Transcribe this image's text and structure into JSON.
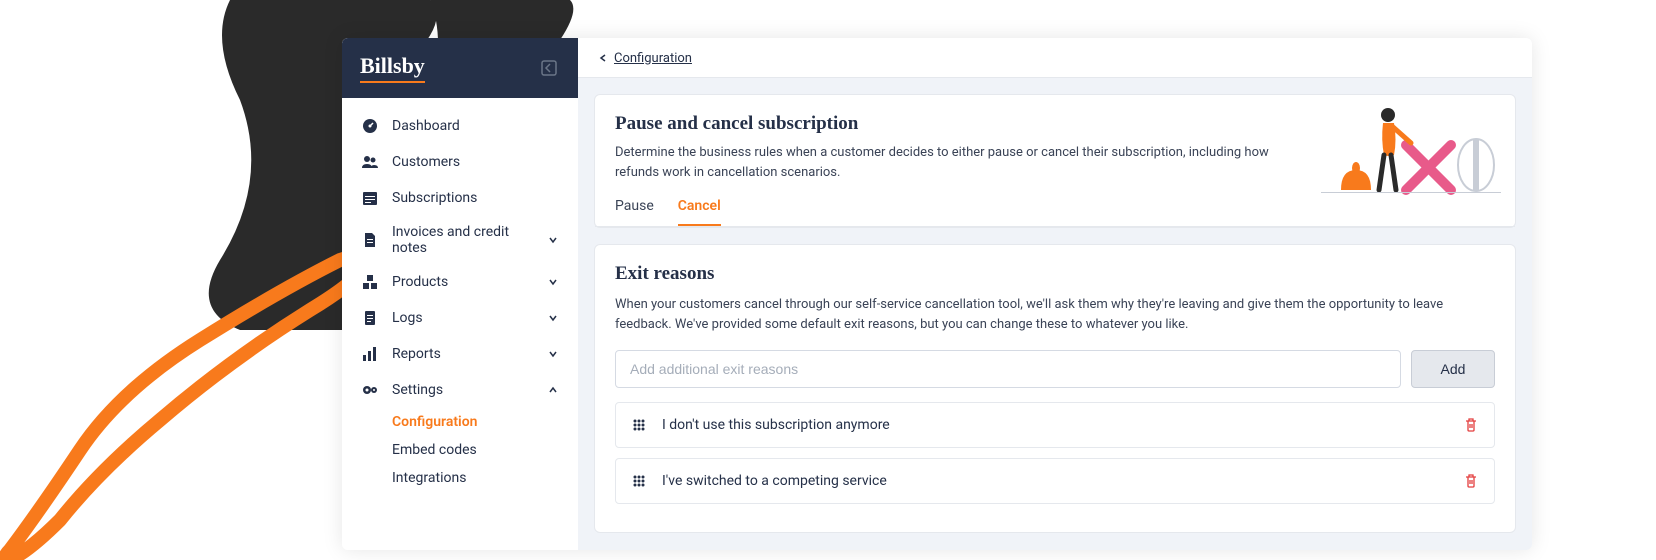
{
  "logo": "Billsby",
  "sidebar": {
    "items": [
      {
        "label": "Dashboard",
        "icon": "gauge"
      },
      {
        "label": "Customers",
        "icon": "users"
      },
      {
        "label": "Subscriptions",
        "icon": "calendar"
      },
      {
        "label": "Invoices and credit notes",
        "icon": "file",
        "chevron": "down"
      },
      {
        "label": "Products",
        "icon": "cubes",
        "chevron": "down"
      },
      {
        "label": "Logs",
        "icon": "clipboard",
        "chevron": "down"
      },
      {
        "label": "Reports",
        "icon": "chart",
        "chevron": "down"
      },
      {
        "label": "Settings",
        "icon": "gear",
        "chevron": "up"
      }
    ],
    "subitems": [
      {
        "label": "Configuration",
        "active": true
      },
      {
        "label": "Embed codes"
      },
      {
        "label": "Integrations"
      }
    ]
  },
  "breadcrumb": {
    "label": "Configuration"
  },
  "header_card": {
    "title": "Pause and cancel subscription",
    "description": "Determine the business rules when a customer decides to either pause or cancel their subscription, including how refunds work in cancellation scenarios.",
    "tabs": [
      {
        "label": "Pause"
      },
      {
        "label": "Cancel",
        "active": true
      }
    ]
  },
  "exit_reasons": {
    "title": "Exit reasons",
    "description": "When your customers cancel through our self-service cancellation tool, we'll ask them why they're leaving and give them the opportunity to leave feedback. We've provided some default exit reasons, but you can change these to whatever you like.",
    "input_placeholder": "Add additional exit reasons",
    "add_button": "Add",
    "reasons": [
      "I don't use this subscription anymore",
      "I've switched to a competing service"
    ]
  }
}
